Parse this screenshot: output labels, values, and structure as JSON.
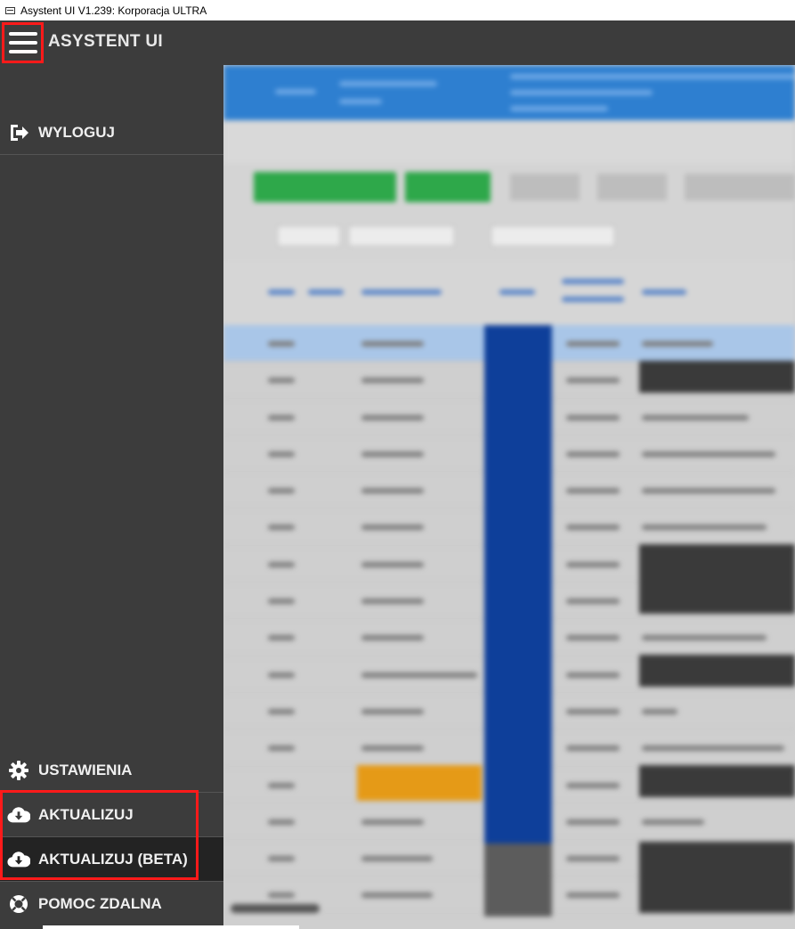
{
  "window": {
    "title": "Asystent UI V1.239: Korporacja ULTRA"
  },
  "header": {
    "app_title": "ASYSTENT UI"
  },
  "sidebar": {
    "items": [
      {
        "label": "WYLOGUJ",
        "icon": "logout-icon"
      },
      {
        "label": "USTAWIENIA",
        "icon": "gear-icon"
      },
      {
        "label": "AKTUALIZUJ",
        "icon": "cloud-download-icon"
      },
      {
        "label": "AKTUALIZUJ (BETA)",
        "icon": "cloud-download-icon"
      },
      {
        "label": "POMOC ZDALNA",
        "icon": "lifebuoy-icon"
      }
    ]
  },
  "colors": {
    "header_bg": "#3c3c3c",
    "highlight": "#ff1a1a",
    "active_item_bg": "#232323",
    "content_accent": "#2e7fd0"
  }
}
